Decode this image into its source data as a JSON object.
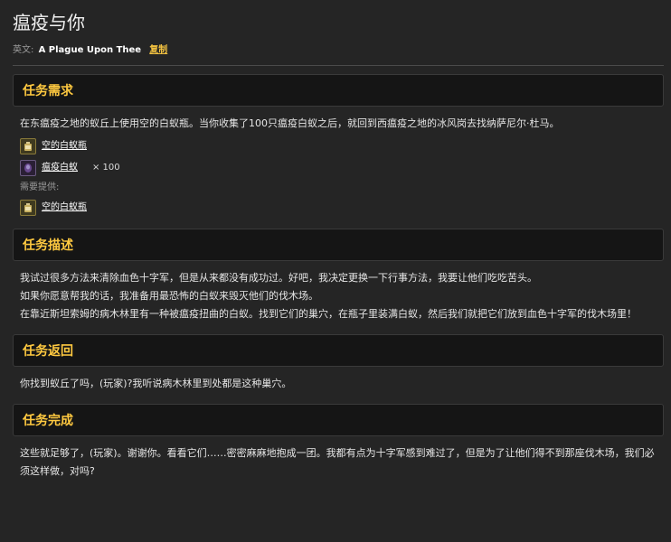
{
  "title": "瘟疫与你",
  "english": {
    "label": "英文:",
    "name": "A Plague Upon Thee",
    "copy": "复制"
  },
  "sections": {
    "requirements": {
      "heading": "任务需求",
      "text": "在东瘟疫之地的蚁丘上使用空的白蚁瓶。当你收集了100只瘟疫白蚁之后，就回到西瘟疫之地的冰风岗去找纳萨尼尔·杜马。",
      "items": [
        {
          "name": "空的白蚁瓶",
          "icon": "bottle-icon",
          "qty": ""
        },
        {
          "name": "瘟疫白蚁",
          "icon": "termite-icon",
          "qty": "× 100"
        }
      ],
      "provided_label": "需要提供:",
      "provided": [
        {
          "name": "空的白蚁瓶",
          "icon": "bottle-icon"
        }
      ]
    },
    "description": {
      "heading": "任务描述",
      "lines": [
        "我试过很多方法来清除血色十字军，但是从来都没有成功过。好吧，我决定更换一下行事方法，我要让他们吃吃苦头。",
        "如果你愿意帮我的话，我准备用最恐怖的白蚁来毁灭他们的伐木场。",
        "在靠近斯坦索姆的病木林里有一种被瘟疫扭曲的白蚁。找到它们的巢穴，在瓶子里装满白蚁，然后我们就把它们放到血色十字军的伐木场里！"
      ]
    },
    "progress": {
      "heading": "任务返回",
      "text": "你找到蚁丘了吗，(玩家)?我听说病木林里到处都是这种巢穴。"
    },
    "completion": {
      "heading": "任务完成",
      "text": "这些就足够了，(玩家)。谢谢你。看看它们……密密麻麻地抱成一团。我都有点为十字军感到难过了，但是为了让他们得不到那座伐木场，我们必须这样做，对吗?"
    }
  },
  "colors": {
    "accent": "#ffc940",
    "background": "#252525",
    "header_bg": "#151515",
    "link": "#f0c040"
  }
}
